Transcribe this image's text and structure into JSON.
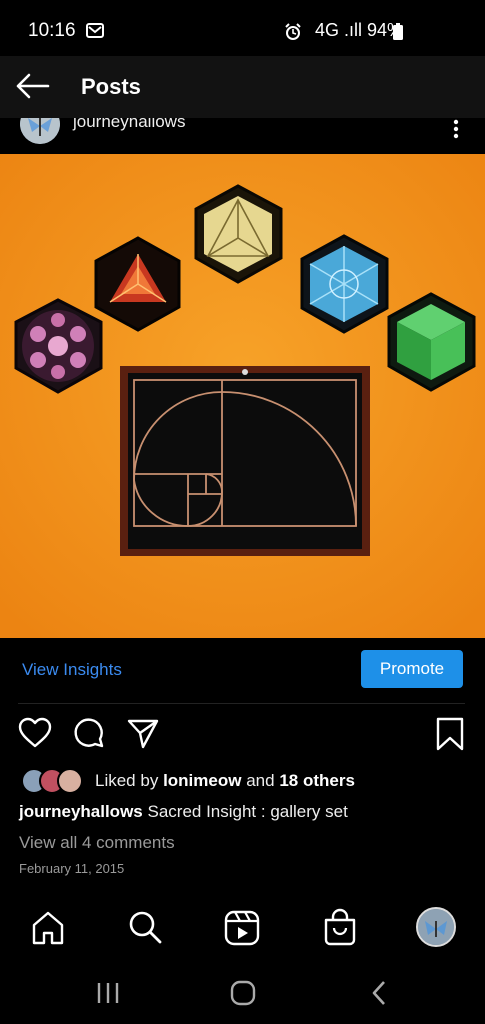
{
  "status_bar": {
    "time": "10:16",
    "right_text": "4G  .ıll 94%",
    "icons": [
      "message-icon",
      "alarm-icon",
      "network-4g-icon",
      "signal-icon",
      "battery-icon"
    ]
  },
  "header": {
    "title": "Posts",
    "back_icon": "arrow-left-icon"
  },
  "post": {
    "author": "journeyhallows",
    "image_alt": "",
    "insights_label": "View Insights",
    "promote_label": "Promote",
    "liked_by_prefix": "Liked by",
    "liked_by_user": "lonimeow",
    "liked_by_and": "and",
    "liked_by_others": "18 others",
    "caption_user": "journeyhallows",
    "caption_text": "Sacred Insight : gallery set",
    "view_comments": "View all 4 comments",
    "date": "February 11, 2015"
  },
  "bottom_nav": {
    "items": [
      "home-icon",
      "search-icon",
      "reels-icon",
      "shop-icon",
      "profile-avatar"
    ]
  },
  "system_nav": {
    "items": [
      "recent-apps-icon",
      "home-circle-icon",
      "back-chevron-icon"
    ]
  },
  "colors": {
    "background": "#000000",
    "header": "#121212",
    "accent_blue": "#1e90e8",
    "link_blue": "#3b8bf0",
    "wall_orange": "#f3921a"
  }
}
